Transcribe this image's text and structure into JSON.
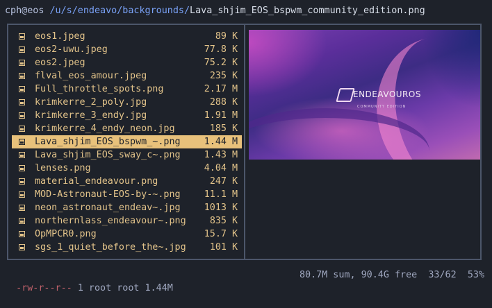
{
  "header": {
    "user_host": "cph@eos",
    "path": "/u/s/endeavo/backgrounds/",
    "file": "Lava_shjim_EOS_bspwm_community_edition.png"
  },
  "files": [
    {
      "name": "eos1.jpeg",
      "size": "89",
      "unit": "K"
    },
    {
      "name": "eos2-uwu.jpeg",
      "size": "77.8",
      "unit": "K"
    },
    {
      "name": "eos2.jpeg",
      "size": "75.2",
      "unit": "K"
    },
    {
      "name": "flval_eos_amour.jpeg",
      "size": "235",
      "unit": "K"
    },
    {
      "name": "Full_throttle_spots.png",
      "size": "2.17",
      "unit": "M"
    },
    {
      "name": "krimkerre_2_poly.jpg",
      "size": "288",
      "unit": "K"
    },
    {
      "name": "krimkerre_3_endy.jpg",
      "size": "1.91",
      "unit": "M"
    },
    {
      "name": "krimkerre_4_endy_neon.jpg",
      "size": "185",
      "unit": "K"
    },
    {
      "name": "Lava_shjim_EOS_bspwm_~.png",
      "size": "1.44",
      "unit": "M",
      "selected": true
    },
    {
      "name": "Lava_shjim_EOS_sway_c~.png",
      "size": "1.43",
      "unit": "M"
    },
    {
      "name": "lenses.png",
      "size": "4.04",
      "unit": "M"
    },
    {
      "name": "material_endeavour.png",
      "size": "247",
      "unit": "K"
    },
    {
      "name": "MOD-Astronaut-EOS-by-~.png",
      "size": "11.1",
      "unit": "M"
    },
    {
      "name": "neon_astronaut_endeav~.jpg",
      "size": "1013",
      "unit": "K"
    },
    {
      "name": "northernlass_endeavour~.png",
      "size": "835",
      "unit": "K"
    },
    {
      "name": "OpMPCR0.png",
      "size": "15.7",
      "unit": "K"
    },
    {
      "name": "sgs_1_quiet_before_the~.jpg",
      "size": "101",
      "unit": "K"
    }
  ],
  "preview": {
    "logo_text": "ENDEAVOUROS",
    "logo_subtitle": "COMMUNITY EDITION"
  },
  "status": {
    "permissions": "-rw-r--r--",
    "links_owner": "1 root root 1.44M",
    "disk": "80.7M sum, 90.4G free",
    "position": "33/62",
    "percent": "53%"
  },
  "colors": {
    "background": "#1e222a",
    "file_text": "#e2c38a",
    "selection_bg": "#e8c17b",
    "path": "#7aa2f7",
    "permissions": "#bf616a",
    "border": "#4c566a"
  },
  "icons": {
    "file_entry": "image-file-icon"
  }
}
